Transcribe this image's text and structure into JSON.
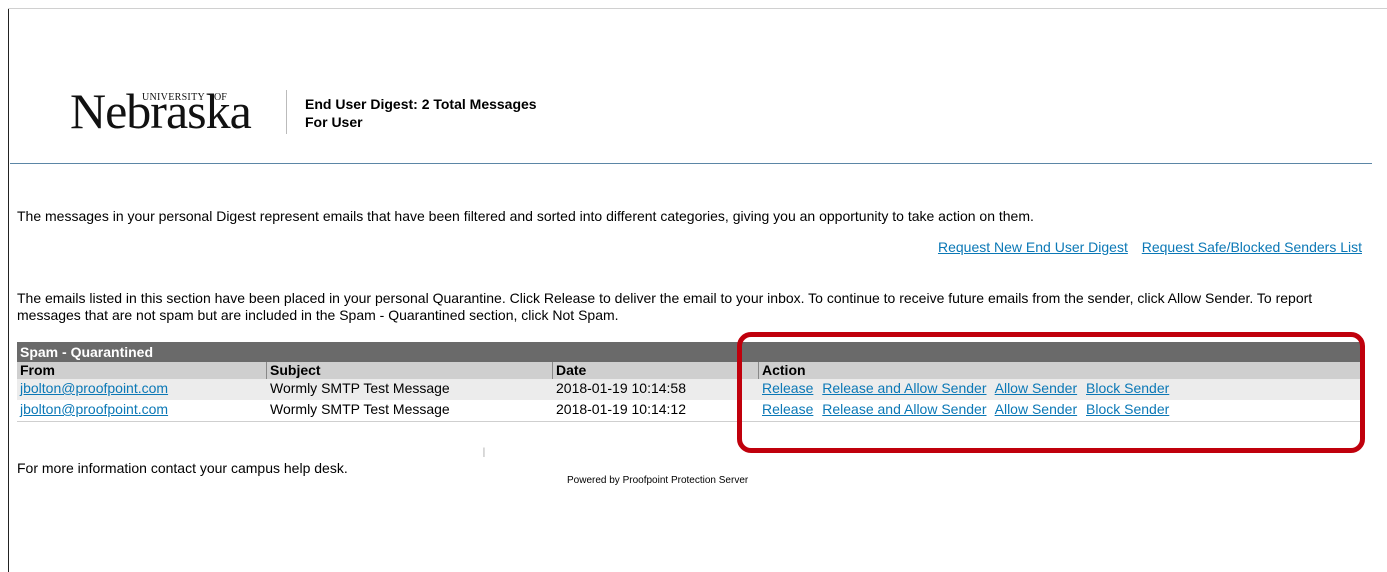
{
  "header": {
    "logo_main": "Nebraska",
    "logo_university": "UNIVERSITY",
    "logo_of": "OF",
    "digest_title": "End User Digest: 2 Total Messages",
    "for_user": "For User"
  },
  "intro_text": "The messages in your personal Digest represent emails that have been filtered and sorted into different categories, giving you an opportunity to take action on them.",
  "request_links": {
    "new_digest": "Request New End User Digest",
    "safe_blocked": "Request Safe/Blocked Senders List"
  },
  "quarantine_text": "The emails listed in this section have been placed in your personal Quarantine. Click Release to deliver the email to your inbox. To continue to receive future emails from the sender, click Allow Sender. To report messages that are not spam but are included in the Spam - Quarantined section, click Not Spam.",
  "table": {
    "title": "Spam - Quarantined",
    "columns": {
      "from": "From",
      "subject": "Subject",
      "date": "Date",
      "action": "Action"
    },
    "rows": [
      {
        "from": "jbolton@proofpoint.com",
        "subject": "Wormly SMTP Test Message",
        "date": "2018-01-19 10:14:58",
        "actions": [
          "Release",
          "Release and Allow Sender",
          "Allow Sender",
          "Block Sender"
        ]
      },
      {
        "from": "jbolton@proofpoint.com",
        "subject": "Wormly SMTP Test Message",
        "date": "2018-01-19 10:14:12",
        "actions": [
          "Release",
          "Release and Allow Sender",
          "Allow Sender",
          "Block Sender"
        ]
      }
    ]
  },
  "footer": {
    "info": "For more information contact your campus help desk.",
    "powered_by": "Powered by Proofpoint Protection Server"
  },
  "colors": {
    "link": "#0b78b6",
    "table_title_bg": "#6a6a6a",
    "table_header_bg": "#cfcfcf",
    "highlight": "#c0000c",
    "rule": "#5b86a6"
  }
}
